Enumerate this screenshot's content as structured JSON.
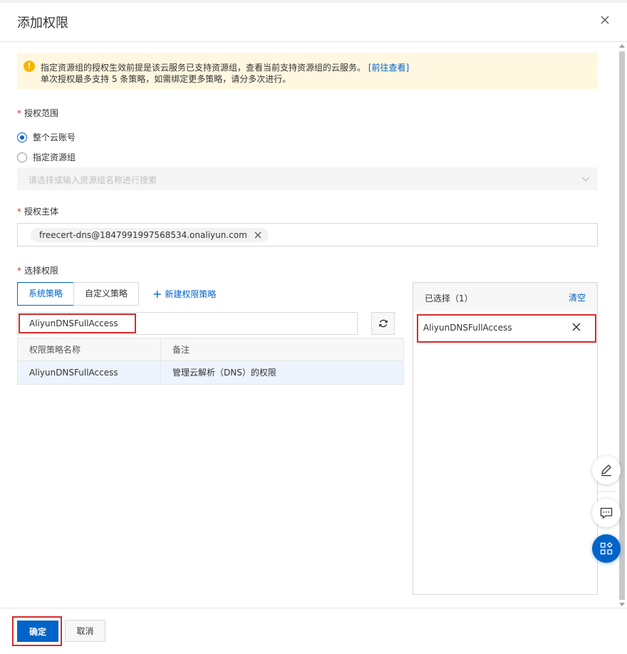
{
  "dialog": {
    "title": "添加权限",
    "close_icon": "close-icon"
  },
  "alert": {
    "icon": "warning-icon",
    "line1": "指定资源组的授权生效前提是该云服务已支持资源组，查看当前支持资源组的云服务。",
    "link": "[前往查看]",
    "line2": "单次授权最多支持 5 条策略，如需绑定更多策略，请分多次进行。"
  },
  "scope": {
    "label": "授权范围",
    "required_mark": "*",
    "options": [
      {
        "label": "整个云账号",
        "checked": true
      },
      {
        "label": "指定资源组",
        "checked": false
      }
    ],
    "resource_group_placeholder": "请选择或输入资源组名称进行搜索"
  },
  "principal": {
    "label": "授权主体",
    "required_mark": "*",
    "tag": "freecert-dns@1847991997568534.onaliyun.com"
  },
  "permissions": {
    "label": "选择权限",
    "required_mark": "*",
    "tabs": [
      {
        "label": "系统策略",
        "active": true
      },
      {
        "label": "自定义策略",
        "active": false
      }
    ],
    "new_policy": "新建权限策略",
    "search_value": "AliyunDNSFullAccess",
    "table": {
      "headers": [
        "权限策略名称",
        "备注"
      ],
      "rows": [
        {
          "name": "AliyunDNSFullAccess",
          "note": "管理云解析（DNS）的权限"
        }
      ]
    }
  },
  "selected": {
    "title": "已选择（1）",
    "clear": "清空",
    "items": [
      "AliyunDNSFullAccess"
    ]
  },
  "footer": {
    "ok": "确定",
    "cancel": "取消"
  },
  "colors": {
    "primary": "#0064c8",
    "highlight": "#d62b2b",
    "alert_bg": "#fff7e0",
    "warning": "#f5b700"
  }
}
